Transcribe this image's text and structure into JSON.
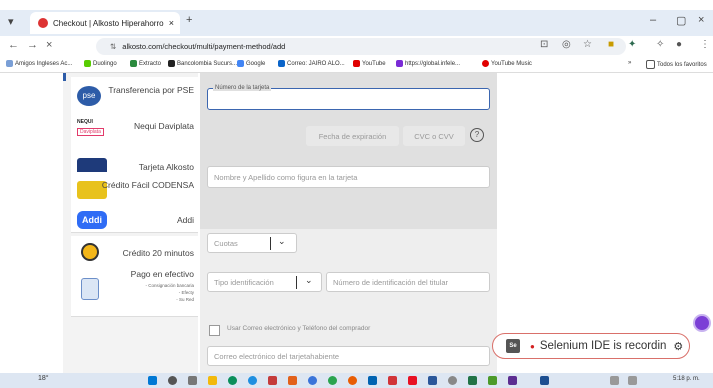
{
  "browser": {
    "tab_title": "Checkout | Alkosto Hiperahorro",
    "tab_close": "×",
    "new_tab": "+",
    "url": "alkosto.com/checkout/multi/payment-method/add",
    "window_min": "–",
    "window_max": "▢",
    "window_close": "×",
    "back": "←",
    "forward": "→",
    "reload": "×",
    "site_info": "⇅",
    "bookmarks": [
      {
        "label": "Amigos Ingleses Ac...",
        "color": "#7a9fd6"
      },
      {
        "label": "Duolingo",
        "color": "#58cc02"
      },
      {
        "label": "Extracto",
        "color": "#2b8a3e"
      },
      {
        "label": "Bancolombia Sucurs...",
        "color": "#222222"
      },
      {
        "label": "Google",
        "color": "#4285f4"
      },
      {
        "label": "Correo: JAIRO ALO...",
        "color": "#0a64c9"
      },
      {
        "label": "YouTube",
        "color": "#e00000"
      },
      {
        "label": "https://global.infele...",
        "color": "#7a2bd6"
      },
      {
        "label": "YouTube Music",
        "color": "#e00000"
      }
    ],
    "bookmarks_more": "»",
    "all_bookmarks": "Todos los favoritos"
  },
  "payment_methods": [
    {
      "label": "Transferencia por PSE",
      "logo": "pse-logo",
      "color": "#2d5ca8"
    },
    {
      "label": "Nequi Daviplata",
      "logo": "nequi-logo",
      "color": "#e23b6b"
    },
    {
      "label": "Tarjeta Alkosto",
      "logo": "alkosto-card-logo",
      "color": "#1e3a7a"
    },
    {
      "label": "Crédito Fácil CODENSA",
      "logo": "codensa-card-logo",
      "color": "#e8c21c"
    },
    {
      "label": "Addi",
      "logo": "addi-logo",
      "color": "#2f6cf5"
    },
    {
      "label": "Crédito 20 minutos",
      "logo": "credito-logo",
      "color": "#f3b619"
    },
    {
      "label": "Pago en efectivo",
      "logo": "cash-logo",
      "color": "#6c8fc9"
    }
  ],
  "pse_name": "pse",
  "nequi_brand": "NEQUI",
  "daviplata_brand": "Daviplata",
  "addi_brand": "Addi",
  "cash_sub": [
    "- Consignación bancaria",
    "- Efecty",
    "- Su Red"
  ],
  "form": {
    "card_number_label": "Número de la tarjeta",
    "expiry_placeholder": "Fecha de expiración",
    "cvc_placeholder": "CVC o CVV",
    "cvc_help": "?",
    "name_placeholder": "Nombre y Apellido como figura en la tarjeta",
    "installments_placeholder": "Cuotas",
    "id_type_placeholder": "Tipo identificación",
    "id_number_placeholder": "Número de identificación del titular",
    "use_contact_label": "Usar Correo electrónico y Teléfono del comprador",
    "email_placeholder": "Correo electrónico del tarjetahabiente"
  },
  "selenium": {
    "text": "Selenium IDE is recordin",
    "badge": "Se",
    "dot": "●"
  },
  "taskbar": {
    "weather": "18°",
    "clock": "5:18 p. m."
  }
}
